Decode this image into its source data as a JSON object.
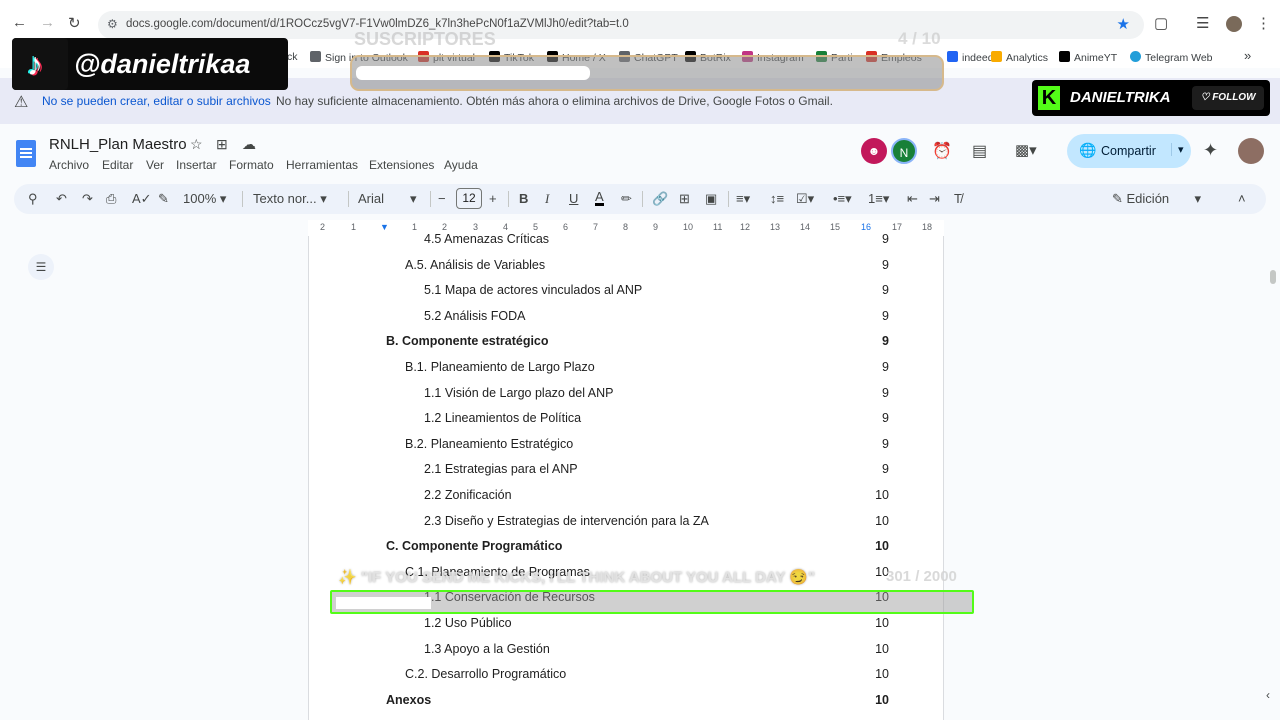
{
  "browser": {
    "url": "docs.google.com/document/d/1ROCcz5vgV7-F1Vw0lmDZ6_k7ln3hePcN0f1aZVMlJh0/edit?tab=t.0",
    "bookmarks": [
      {
        "label": "ck"
      },
      {
        "label": "Sign in to Outlook",
        "color": "#5f6368"
      },
      {
        "label": "plt virtual",
        "color": "#d93025"
      },
      {
        "label": "TikTok",
        "color": "#000000"
      },
      {
        "label": "Home / X",
        "color": "#000000"
      },
      {
        "label": "ChatGPT",
        "color": "#5f6368"
      },
      {
        "label": "BotRix",
        "color": "#000000"
      },
      {
        "label": "Instagram",
        "color": "#c13584"
      },
      {
        "label": "Parti",
        "color": "#188038"
      },
      {
        "label": "Empleos",
        "color": "#d93025"
      },
      {
        "label": "indeed",
        "color": "#2164f3"
      },
      {
        "label": "Analytics",
        "color": "#f9ab00"
      },
      {
        "label": "AnimeYT",
        "color": "#000000"
      },
      {
        "label": "Telegram Web",
        "color": "#229ed9"
      }
    ]
  },
  "banner": {
    "warning": "No se pueden crear, editar o subir archivos",
    "detail": "No hay suficiente almacenamiento. Obtén más ahora o elimina archivos de Drive, Google Fotos o Gmail."
  },
  "doc": {
    "title": "RNLH_Plan Maestro",
    "menus": [
      "Archivo",
      "Editar",
      "Ver",
      "Insertar",
      "Formato",
      "Herramientas",
      "Extensiones",
      "Ayuda"
    ],
    "share_label": "Compartir",
    "avatar_n": "N"
  },
  "toolbar": {
    "zoom": "100%",
    "style": "Texto nor...",
    "font": "Arial",
    "font_size": "12",
    "mode": "Edición"
  },
  "ruler": [
    "2",
    "1",
    "1",
    "2",
    "3",
    "4",
    "5",
    "6",
    "7",
    "8",
    "9",
    "10",
    "11",
    "12",
    "13",
    "14",
    "15",
    "16",
    "17",
    "18"
  ],
  "toc": [
    {
      "text": "4.5 Amenazas Críticas",
      "page": "9",
      "level": 2,
      "bold": false
    },
    {
      "text": "A.5. Análisis de Variables",
      "page": "9",
      "level": 1,
      "bold": false
    },
    {
      "text": "5.1 Mapa de actores vinculados al ANP",
      "page": "9",
      "level": 2,
      "bold": false
    },
    {
      "text": "5.2 Análisis FODA",
      "page": "9",
      "level": 2,
      "bold": false
    },
    {
      "text": "B. Componente estratégico",
      "page": "9",
      "level": 0,
      "bold": true
    },
    {
      "text": "B.1. Planeamiento de Largo Plazo",
      "page": "9",
      "level": 1,
      "bold": false
    },
    {
      "text": "1.1 Visión de Largo plazo del ANP",
      "page": "9",
      "level": 2,
      "bold": false
    },
    {
      "text": "1.2 Lineamientos de Política",
      "page": "9",
      "level": 2,
      "bold": false
    },
    {
      "text": "B.2. Planeamiento Estratégico",
      "page": "9",
      "level": 1,
      "bold": false
    },
    {
      "text": "2.1 Estrategias para el ANP",
      "page": "9",
      "level": 2,
      "bold": false
    },
    {
      "text": "2.2 Zonificación",
      "page": "10",
      "level": 2,
      "bold": false
    },
    {
      "text": "2.3 Diseño y Estrategias de intervención para la ZA",
      "page": "10",
      "level": 2,
      "bold": false
    },
    {
      "text": "C. Componente Programático",
      "page": "10",
      "level": 0,
      "bold": true
    },
    {
      "text": "C.1. Planeamiento de Programas",
      "page": "10",
      "level": 1,
      "bold": false
    },
    {
      "text": "1.1 Conservación de Recursos",
      "page": "10",
      "level": 2,
      "bold": false
    },
    {
      "text": "1.2 Uso Público",
      "page": "10",
      "level": 2,
      "bold": false
    },
    {
      "text": "1.3 Apoyo a la Gestión",
      "page": "10",
      "level": 2,
      "bold": false
    },
    {
      "text": "C.2. Desarrollo Programático",
      "page": "10",
      "level": 1,
      "bold": false
    },
    {
      "text": "Anexos",
      "page": "10",
      "level": 0,
      "bold": true
    }
  ],
  "overlays": {
    "tiktok_handle": "@danieltrikaa",
    "subs_title": "SUSCRIPTORES",
    "subs_count": "4 / 10",
    "subs_progress": 0.4,
    "kick_name": "DANIELTRIKA",
    "kick_follow": "FOLLOW",
    "goal_text": "\"IF YOU SEND ME KICKS, I'LL THINK ABOUT YOU ALL DAY 😏\"",
    "goal_emoji": "✨",
    "goal_count": "301 / 2000",
    "goal_progress": 0.15,
    "accent": "#53fc18"
  }
}
